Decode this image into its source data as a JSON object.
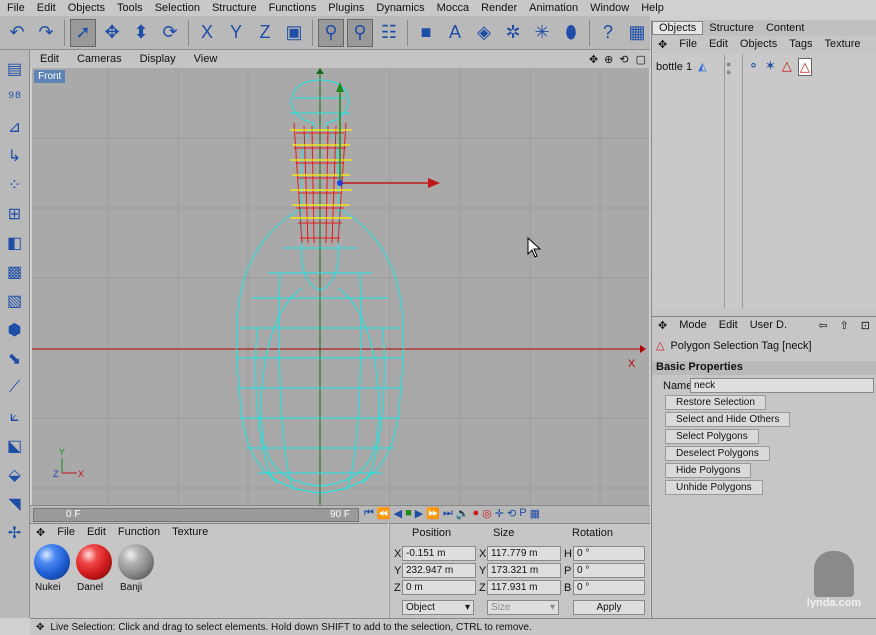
{
  "menubar": [
    "File",
    "Edit",
    "Objects",
    "Tools",
    "Selection",
    "Structure",
    "Functions",
    "Plugins",
    "Dynamics",
    "Mocca",
    "Render",
    "Animation",
    "Window",
    "Help"
  ],
  "viewport": {
    "menu": [
      "Edit",
      "Cameras",
      "Display",
      "View"
    ],
    "label": "Front",
    "axis_x": "X",
    "axis_y": "Y",
    "axis_z": "Z"
  },
  "timeline": {
    "start": "0 F",
    "end": "90 F"
  },
  "material_manager": {
    "menu": [
      "File",
      "Edit",
      "Function",
      "Texture"
    ],
    "materials": [
      {
        "name": "Nukei",
        "color": "#1f5fd6"
      },
      {
        "name": "Danel",
        "color": "#d31c1c"
      },
      {
        "name": "Banji",
        "color": "#8c8c8c"
      }
    ]
  },
  "coordinates": {
    "headers": [
      "Position",
      "Size",
      "Rotation"
    ],
    "rows": [
      {
        "axis": "X",
        "pos": "-0.151 m",
        "size_axis": "X",
        "size": "117.779 m",
        "rot_axis": "H",
        "rot": "0 °"
      },
      {
        "axis": "Y",
        "pos": "232.947 m",
        "size_axis": "Y",
        "size": "173.321 m",
        "rot_axis": "P",
        "rot": "0 °"
      },
      {
        "axis": "Z",
        "pos": "0 m",
        "size_axis": "Z",
        "size": "117.931 m",
        "rot_axis": "B",
        "rot": "0 °"
      }
    ],
    "mode": "Object",
    "size_mode": "Size",
    "apply": "Apply"
  },
  "object_manager": {
    "tabs": [
      "Objects",
      "Structure",
      "Content"
    ],
    "menu": [
      "File",
      "Edit",
      "Objects",
      "Tags",
      "Texture"
    ],
    "object": "bottle 1"
  },
  "attribute_manager": {
    "menu": [
      "Mode",
      "Edit",
      "User D."
    ],
    "tag_title": "Polygon Selection Tag [neck]",
    "section": "Basic Properties",
    "name_label": "Name",
    "name_value": "neck",
    "buttons": [
      "Restore Selection",
      "Select and Hide Others",
      "Select Polygons",
      "Deselect Polygons",
      "Hide Polygons",
      "Unhide Polygons"
    ]
  },
  "status": "Live Selection: Click and drag to select elements. Hold down SHIFT to add to the selection, CTRL to remove.",
  "watermark": "lynda.com",
  "colors": {
    "wire": "#19e8e8",
    "selected": "#e61a1a",
    "accent": "#5d82b4"
  }
}
